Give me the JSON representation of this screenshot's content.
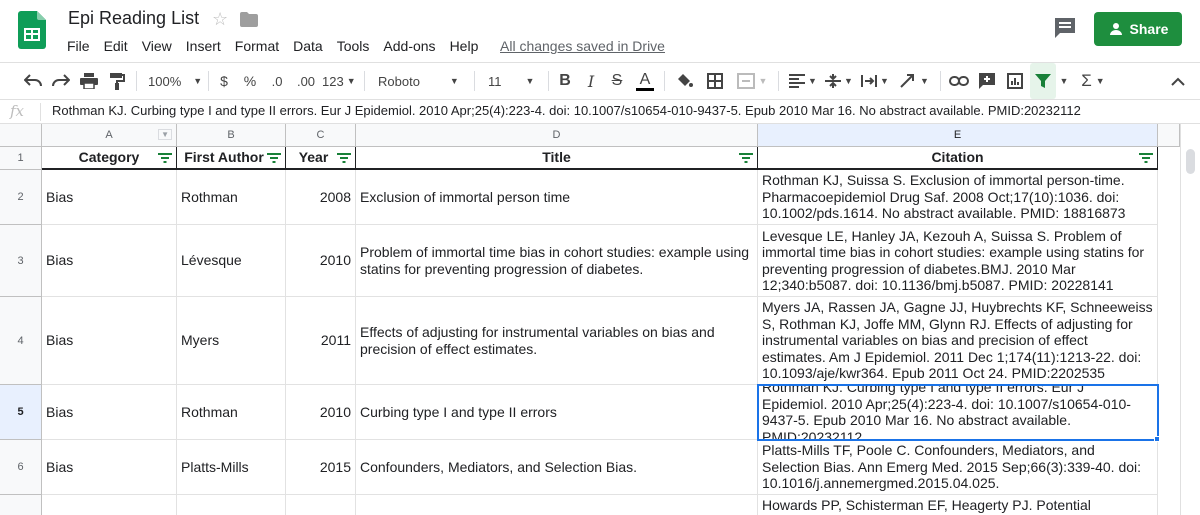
{
  "doc": {
    "title": "Epi Reading List"
  },
  "menu": [
    "File",
    "Edit",
    "View",
    "Insert",
    "Format",
    "Data",
    "Tools",
    "Add-ons",
    "Help"
  ],
  "save_status": "All changes saved in Drive",
  "share_label": "Share",
  "toolbar": {
    "zoom": "100%",
    "currency": "$",
    "percent": "%",
    "dec_decrease": ".0",
    "dec_increase": ".00",
    "more_formats": "123",
    "font": "Roboto",
    "font_size": "11"
  },
  "formula_bar": {
    "fx": "fx",
    "content": "Rothman KJ. Curbing type I and type II errors. Eur J Epidemiol. 2010 Apr;25(4):223-4. doi: 10.1007/s10654-010-9437-5. Epub 2010 Mar 16. No abstract available. PMID:20232112"
  },
  "columns": [
    "A",
    "B",
    "C",
    "D",
    "E"
  ],
  "header_row": {
    "number": "1",
    "category": "Category",
    "first_author": "First Author",
    "year": "Year",
    "title": "Title",
    "citation": "Citation"
  },
  "rows": [
    {
      "number": "2",
      "category": "Bias",
      "author": "Rothman",
      "year": "2008",
      "title": "Exclusion of immortal person time",
      "citation": "Rothman KJ, Suissa S. Exclusion of immortal person-time. Pharmacoepidemiol Drug Saf. 2008 Oct;17(10):1036. doi: 10.1002/pds.1614. No abstract available. PMID: 18816873"
    },
    {
      "number": "3",
      "category": "Bias",
      "author": "Lévesque",
      "year": "2010",
      "title": "Problem of immortal time bias in cohort studies: example using statins for preventing progression of diabetes.",
      "citation": "Levesque LE, Hanley JA, Kezouh A, Suissa S. Problem of immortal time bias in cohort studies: example using statins for preventing progression of diabetes.BMJ. 2010 Mar 12;340:b5087. doi: 10.1136/bmj.b5087. PMID: 20228141"
    },
    {
      "number": "4",
      "category": "Bias",
      "author": "Myers",
      "year": "2011",
      "title": "Effects of adjusting for instrumental variables on bias and precision of effect estimates.",
      "citation": "Myers JA, Rassen JA, Gagne JJ, Huybrechts KF, Schneeweiss S, Rothman KJ, Joffe MM, Glynn RJ. Effects of adjusting for instrumental variables on bias and precision of effect estimates. Am J Epidemiol. 2011 Dec 1;174(11):1213-22. doi: 10.1093/aje/kwr364. Epub 2011 Oct 24. PMID:2202535"
    },
    {
      "number": "5",
      "category": "Bias",
      "author": "Rothman",
      "year": "2010",
      "title": "Curbing type I and type II errors",
      "citation": "Rothman KJ. Curbing type I and type II errors. Eur J Epidemiol. 2010 Apr;25(4):223-4. doi: 10.1007/s10654-010-9437-5. Epub 2010 Mar 16. No abstract available. PMID:20232112"
    },
    {
      "number": "6",
      "category": "Bias",
      "author": "Platts-Mills",
      "year": "2015",
      "title": "Confounders, Mediators, and Selection Bias.",
      "citation": "Platts-Mills TF, Poole C. Confounders, Mediators, and Selection Bias. Ann Emerg Med. 2015 Sep;66(3):339-40. doi: 10.1016/j.annemergmed.2015.04.025."
    },
    {
      "number": "",
      "category": "",
      "author": "",
      "year": "",
      "title": "",
      "citation": "Howards PP, Schisterman EF, Heagerty PJ. Potential"
    }
  ],
  "colors": {
    "share_green": "#1e8e3e",
    "selection_blue": "#1a73e8",
    "filter_green": "#188038"
  }
}
